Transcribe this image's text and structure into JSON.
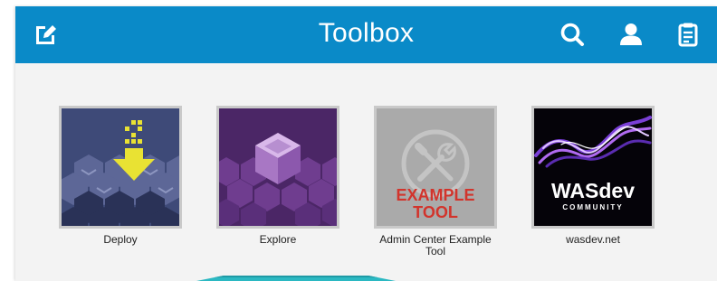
{
  "header": {
    "title": "Toolbox",
    "background_color": "#0a8ac8",
    "left_icon": "edit-icon",
    "right_icons": [
      "search-icon",
      "user-icon",
      "clipboard-icon"
    ]
  },
  "tools": [
    {
      "label": "Deploy",
      "image": "deploy-tile"
    },
    {
      "label": "Explore",
      "image": "explore-tile"
    },
    {
      "label": "Admin Center Example Tool",
      "image": "example-tool-tile",
      "image_text_line1": "EXAMPLE",
      "image_text_line2": "TOOL"
    },
    {
      "label": "wasdev.net",
      "image": "wasdev-tile",
      "image_text_main": "WASdev",
      "image_text_sub": "COMMUNITY"
    }
  ]
}
